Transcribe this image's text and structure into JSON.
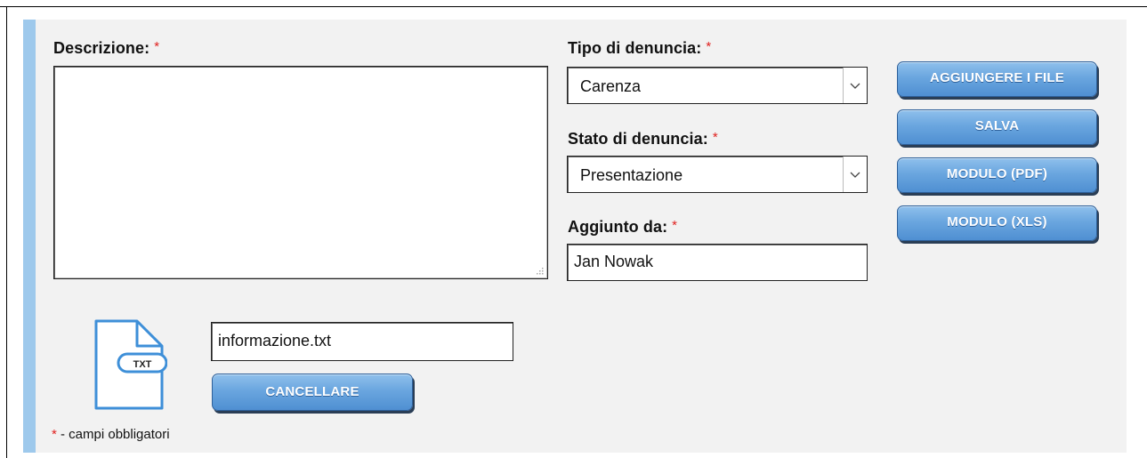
{
  "form": {
    "description": {
      "label": "Descrizione:",
      "required_mark": "*",
      "value": ""
    },
    "report_type": {
      "label": "Tipo di denuncia:",
      "required_mark": "*",
      "selected": "Carenza"
    },
    "report_status": {
      "label": "Stato di denuncia:",
      "required_mark": "*",
      "selected": "Presentazione"
    },
    "added_by": {
      "label": "Aggiunto da:",
      "required_mark": "*",
      "value": "Jan Nowak"
    }
  },
  "actions": {
    "add_files": "AGGIUNGERE I FILE",
    "save": "SALVA",
    "form_pdf": "MODULO (PDF)",
    "form_xls": "MODULO (XLS)"
  },
  "attachment": {
    "icon": "txt-file-icon",
    "icon_text": "TXT",
    "filename": "informazione.txt",
    "delete_label": "CANCELLARE"
  },
  "footnote": {
    "star": "*",
    "text": " - campi obbligatori"
  },
  "colors": {
    "accent_bar": "#9ec9ec",
    "panel": "#f2f2f2",
    "button": "#5a9ad8",
    "required": "#e0211f",
    "file_icon": "#3e8fd8"
  }
}
